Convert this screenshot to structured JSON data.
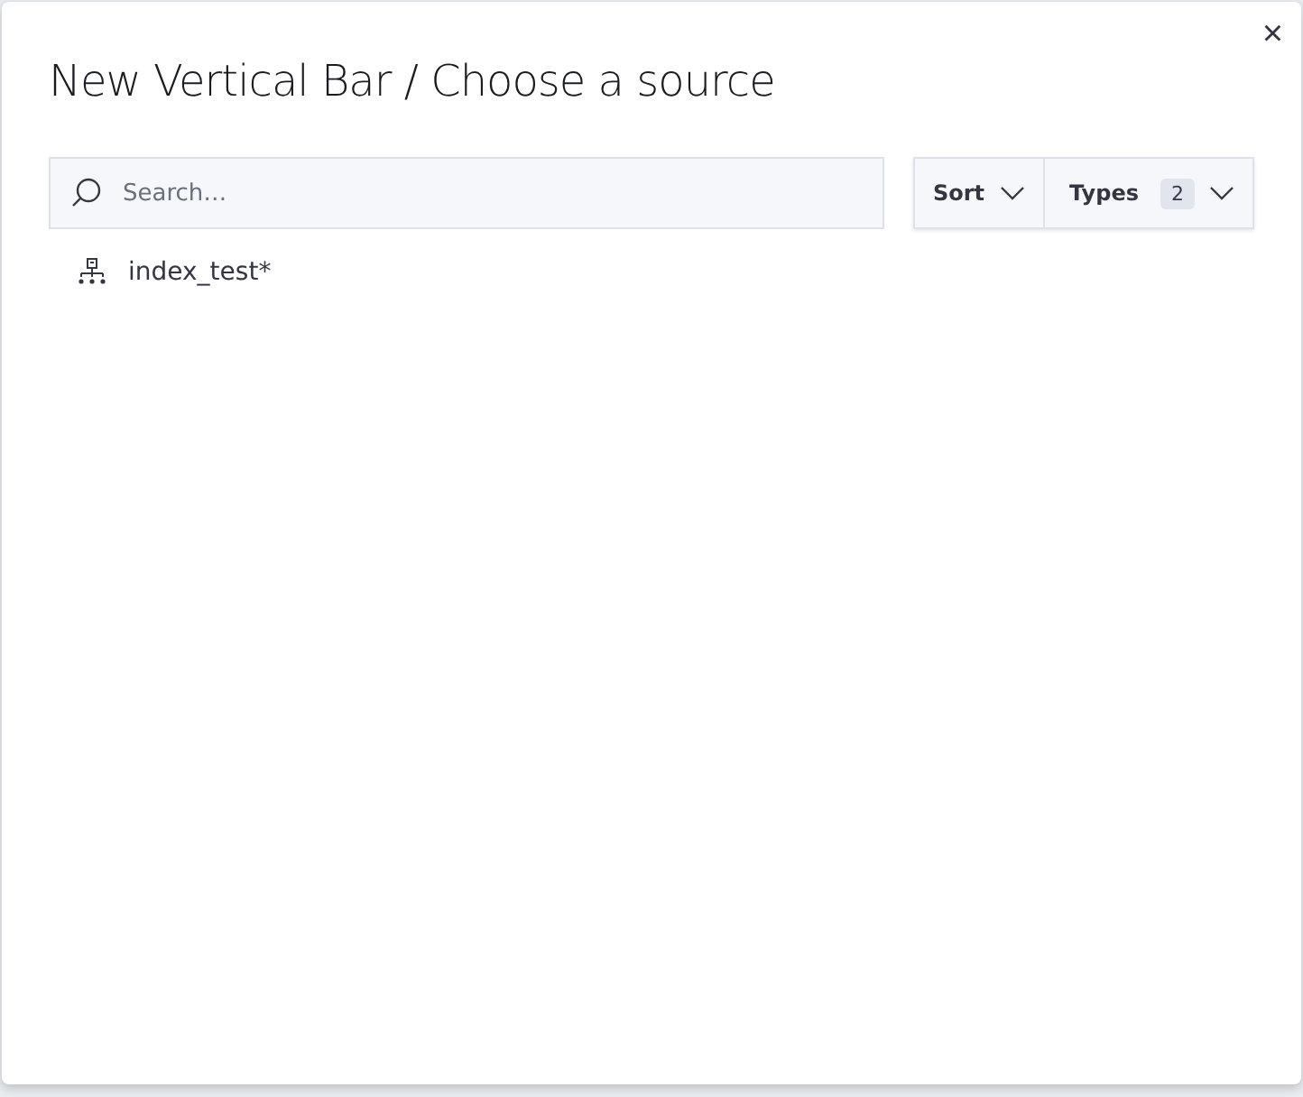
{
  "dialog": {
    "title": "New Vertical Bar / Choose a source",
    "close": "×"
  },
  "search": {
    "placeholder": "Search…"
  },
  "sort": {
    "label": "Sort"
  },
  "types": {
    "label": "Types",
    "count": "2"
  },
  "sources": [
    {
      "name": "index_test*",
      "kind": "index-pattern"
    }
  ]
}
